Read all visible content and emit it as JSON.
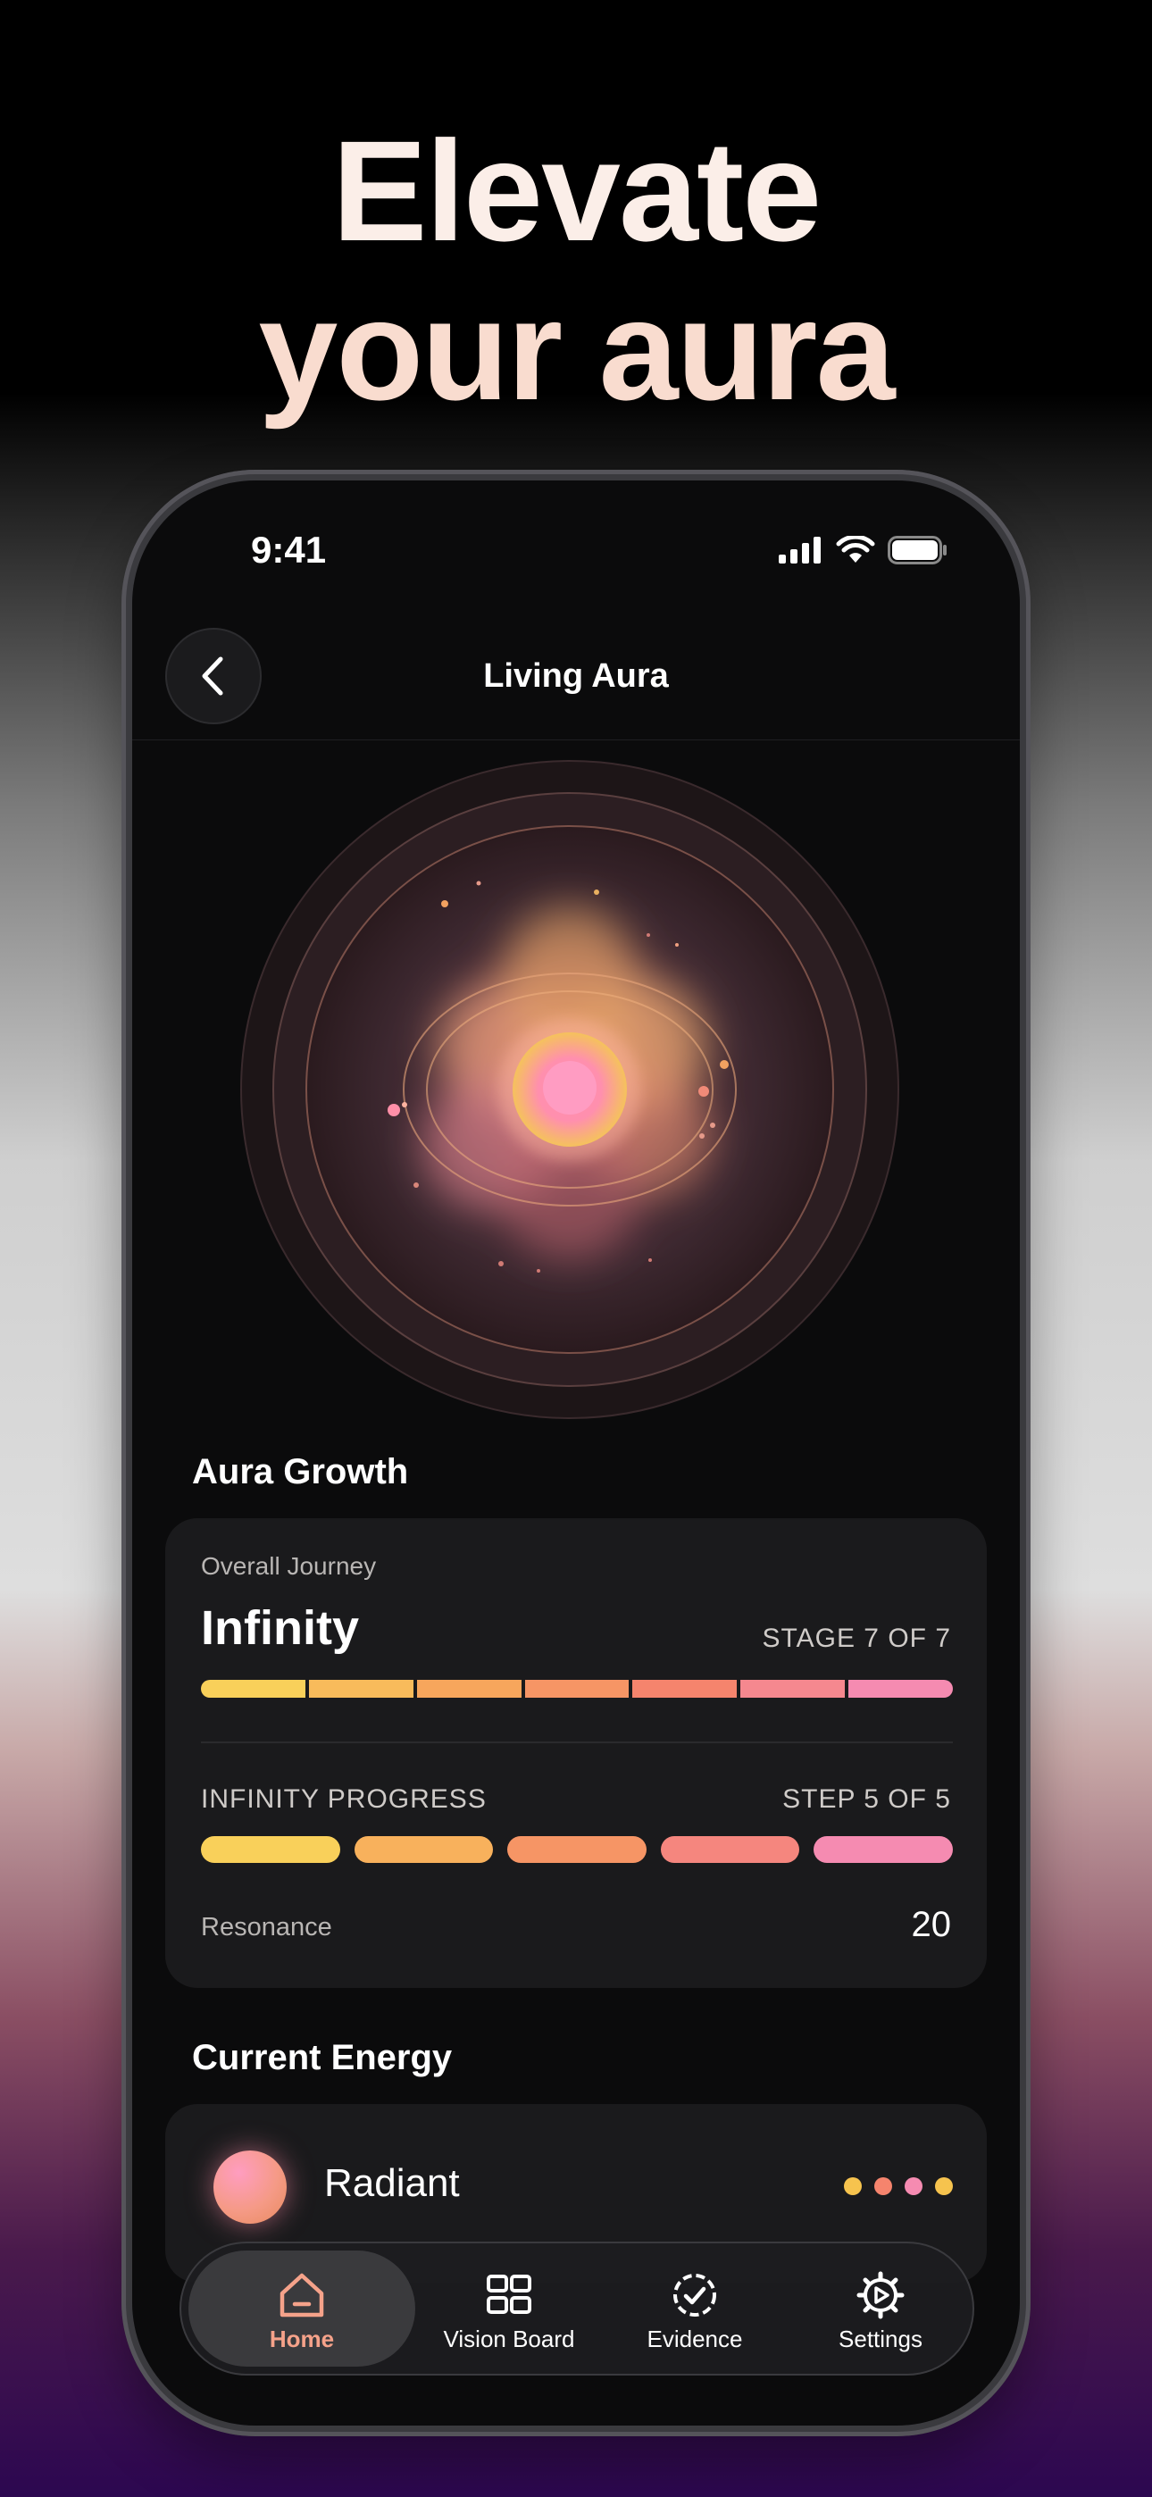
{
  "headline": {
    "line1": "Elevate",
    "line2": "your aura"
  },
  "status_bar": {
    "time": "9:41",
    "icons": [
      "signal-icon",
      "wifi-icon",
      "battery-icon"
    ]
  },
  "nav": {
    "title": "Living Aura",
    "back_icon": "chevron-left-icon"
  },
  "aura_growth": {
    "section_title": "Aura Growth",
    "overall_label": "Overall Journey",
    "stage_name": "Infinity",
    "stage_text": "STAGE 7 OF 7",
    "stage_current": 7,
    "stage_total": 7,
    "progress_label": "INFINITY PROGRESS",
    "step_text": "STEP 5 OF 5",
    "step_current": 5,
    "step_total": 5,
    "resonance_label": "Resonance",
    "resonance_value": "20"
  },
  "current_energy": {
    "section_title": "Current Energy",
    "name": "Radiant",
    "dot_colors": [
      "#f6c34e",
      "#f5846d",
      "#f58bb1",
      "#f6c34e"
    ]
  },
  "tabs": [
    {
      "label": "Home",
      "icon": "home-icon",
      "active": true
    },
    {
      "label": "Vision Board",
      "icon": "grid-icon",
      "active": false
    },
    {
      "label": "Evidence",
      "icon": "check-circle-icon",
      "active": false
    },
    {
      "label": "Settings",
      "icon": "gear-icon",
      "active": false
    }
  ],
  "colors": {
    "accent": "#f5a28a",
    "gradient": [
      "#f9d05a",
      "#f7a65c",
      "#f5846d",
      "#f58bb1"
    ]
  }
}
